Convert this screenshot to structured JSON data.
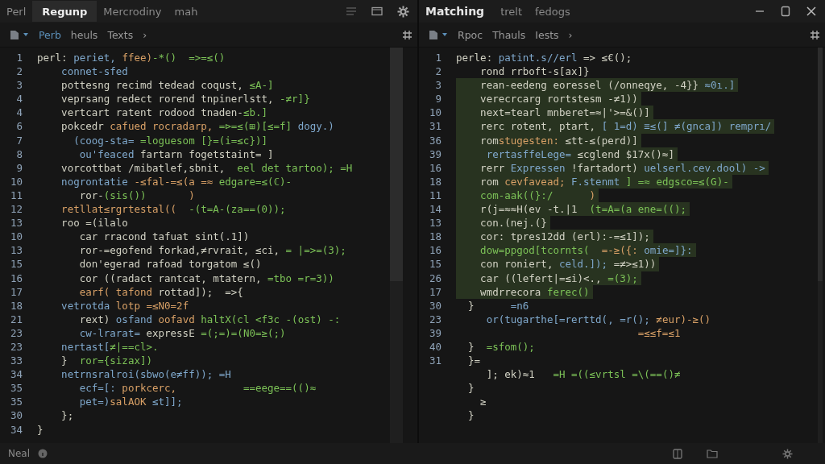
{
  "left_pane": {
    "tabs": [
      {
        "label": "Perl",
        "selected": false
      },
      {
        "label": "Regunp",
        "selected": true
      },
      {
        "label": "Mercrodiny",
        "selected": false
      },
      {
        "label": "mah",
        "selected": false
      }
    ],
    "breadcrumbs": [
      {
        "label": "Perb",
        "selected": true
      },
      {
        "label": "heuls",
        "selected": false
      },
      {
        "label": "Texts",
        "selected": false
      }
    ],
    "breadcrumb_chevron": "›",
    "lines": [
      {
        "num": "1",
        "highlighted": false,
        "segments": [
          {
            "kind": "plain",
            "text": "perl: "
          },
          {
            "kind": "var",
            "text": "periet, "
          },
          {
            "kind": "fn",
            "text": "ffee)"
          },
          {
            "kind": "op",
            "text": "-*()  =>=≤()"
          }
        ]
      },
      {
        "num": "2",
        "highlighted": false,
        "segments": [
          {
            "kind": "var",
            "text": "    connet-sfed"
          }
        ]
      },
      {
        "num": "3",
        "highlighted": false,
        "segments": [
          {
            "kind": "plain",
            "text": "    pottesng recimd tedead coqust, "
          },
          {
            "kind": "op",
            "text": "≤A-]"
          }
        ]
      },
      {
        "num": "4",
        "highlighted": false,
        "segments": [
          {
            "kind": "plain",
            "text": "    veprsang redect rorend tnpinerlstt, "
          },
          {
            "kind": "op",
            "text": "-≠r]}"
          }
        ]
      },
      {
        "num": "4",
        "highlighted": false,
        "segments": [
          {
            "kind": "plain",
            "text": "    vertcart ratent rodood tnaden-"
          },
          {
            "kind": "op",
            "text": "≤b.]"
          }
        ]
      },
      {
        "num": "6",
        "highlighted": false,
        "segments": [
          {
            "kind": "plain",
            "text": "    pokcedr "
          },
          {
            "kind": "fn",
            "text": "cafued rocradarp, "
          },
          {
            "kind": "op",
            "text": "=⊳=≤(⊞)[≤=f] "
          },
          {
            "kind": "var",
            "text": "dogy.)"
          }
        ]
      },
      {
        "num": "7",
        "highlighted": false,
        "segments": [
          {
            "kind": "var",
            "text": "      (coog-sta= "
          },
          {
            "kind": "op",
            "text": "=loguesom [}=(i=≤c})]"
          }
        ]
      },
      {
        "num": "8",
        "highlighted": false,
        "segments": [
          {
            "kind": "var",
            "text": "       ou'feaced "
          },
          {
            "kind": "plain",
            "text": "fartarn fogetstaint= ]"
          }
        ]
      },
      {
        "num": "9",
        "highlighted": false,
        "segments": [
          {
            "kind": "plain",
            "text": "    vorcottbat /mibatlef,sbnit,  "
          },
          {
            "kind": "op",
            "text": "eel det tartoo); =H"
          }
        ]
      },
      {
        "num": "10",
        "highlighted": false,
        "segments": [
          {
            "kind": "var",
            "text": "    nogrontatie "
          },
          {
            "kind": "fn",
            "text": "-≤fal-=≤(a =≈ "
          },
          {
            "kind": "op",
            "text": "edgare=≤(ℂ)-"
          }
        ]
      },
      {
        "num": "11",
        "highlighted": false,
        "segments": [
          {
            "kind": "plain",
            "text": "       ror-"
          },
          {
            "kind": "op",
            "text": "(sis())"
          },
          {
            "kind": "fn",
            "text": "       )"
          }
        ]
      },
      {
        "num": "12",
        "highlighted": false,
        "segments": [
          {
            "kind": "fn",
            "text": "    retllat≤rgrtestal((  "
          },
          {
            "kind": "op",
            "text": "-(t=A-(za==(0));"
          }
        ]
      },
      {
        "num": "13",
        "highlighted": false,
        "segments": [
          {
            "kind": "plain",
            "text": "    roo =(ilalo"
          }
        ]
      },
      {
        "num": "10",
        "highlighted": false,
        "segments": [
          {
            "kind": "plain",
            "text": "       car rracond tafuat sint(.1])"
          }
        ]
      },
      {
        "num": "13",
        "highlighted": false,
        "segments": [
          {
            "kind": "plain",
            "text": "       ror-=egofend forkad,≠rvrait, ≤ci, "
          },
          {
            "kind": "op",
            "text": "= |=>=(3);"
          }
        ]
      },
      {
        "num": "15",
        "highlighted": false,
        "segments": [
          {
            "kind": "plain",
            "text": "       don'egerad rafoad torgatom ≤()"
          }
        ]
      },
      {
        "num": "16",
        "highlighted": false,
        "segments": [
          {
            "kind": "plain",
            "text": "       cor ((radact rantcat, mtatern, "
          },
          {
            "kind": "op",
            "text": "=tbo =r=3))"
          }
        ]
      },
      {
        "num": "17",
        "highlighted": false,
        "segments": [
          {
            "kind": "fn",
            "text": "       earf( tafond "
          },
          {
            "kind": "plain",
            "text": "rottad]);  =>{"
          }
        ]
      },
      {
        "num": "18",
        "highlighted": false,
        "segments": [
          {
            "kind": "var",
            "text": "    vetrotda "
          },
          {
            "kind": "fn",
            "text": "lotp =≤N0=2f"
          }
        ]
      },
      {
        "num": "21",
        "highlighted": false,
        "segments": [
          {
            "kind": "plain",
            "text": "       rext) "
          },
          {
            "kind": "var",
            "text": "osfand "
          },
          {
            "kind": "fn",
            "text": "oofavd "
          },
          {
            "kind": "op",
            "text": "haltX(cl <f3c -(ost) -:"
          }
        ]
      },
      {
        "num": "23",
        "highlighted": false,
        "segments": [
          {
            "kind": "var",
            "text": "       cw-lrarat= "
          },
          {
            "kind": "plain",
            "text": "expressE "
          },
          {
            "kind": "op",
            "text": "=(;=)=(N0=≥(;)"
          }
        ]
      },
      {
        "num": "23",
        "highlighted": false,
        "segments": [
          {
            "kind": "var",
            "text": "    nertast["
          },
          {
            "kind": "op",
            "text": "≠|==cl>."
          }
        ]
      },
      {
        "num": "33",
        "highlighted": false,
        "segments": [
          {
            "kind": "plain",
            "text": "    }  "
          },
          {
            "kind": "op",
            "text": "ror={sizax])"
          }
        ]
      },
      {
        "num": "34",
        "highlighted": false,
        "segments": [
          {
            "kind": "var",
            "text": "    netrnsralroi(sbwo(e≠ff)); =H"
          }
        ]
      },
      {
        "num": "35",
        "highlighted": false,
        "segments": [
          {
            "kind": "var",
            "text": "       ecf=[: "
          },
          {
            "kind": "fn",
            "text": "porkcerc,           "
          },
          {
            "kind": "op",
            "text": "==eege==(()≈"
          }
        ]
      },
      {
        "num": "35",
        "highlighted": false,
        "segments": [
          {
            "kind": "var",
            "text": "       pet=)"
          },
          {
            "kind": "fn",
            "text": "salAOK "
          },
          {
            "kind": "var",
            "text": "≤t]];"
          }
        ]
      },
      {
        "num": "30",
        "highlighted": false,
        "segments": [
          {
            "kind": "plain",
            "text": "    };"
          }
        ]
      },
      {
        "num": "34",
        "highlighted": false,
        "segments": [
          {
            "kind": "plain",
            "text": "}"
          }
        ]
      }
    ]
  },
  "right_pane": {
    "title": "Matching",
    "tabs": [
      {
        "label": "trelt",
        "selected": false
      },
      {
        "label": "fedogs",
        "selected": false
      }
    ],
    "breadcrumbs": [
      {
        "label": "Rpoc",
        "selected": false
      },
      {
        "label": "Thauls",
        "selected": false
      },
      {
        "label": "Iests",
        "selected": false
      }
    ],
    "breadcrumb_chevron": "›",
    "lines": [
      {
        "num": "1",
        "highlighted": false,
        "segments": [
          {
            "kind": "plain",
            "text": "perle: "
          },
          {
            "kind": "var",
            "text": "patint.s//erl "
          },
          {
            "kind": "plain",
            "text": "=> ≤€();"
          }
        ]
      },
      {
        "num": "2",
        "highlighted": false,
        "segments": [
          {
            "kind": "plain",
            "text": "    rond rrboft-s[ax]}"
          }
        ]
      },
      {
        "num": "3",
        "highlighted": true,
        "segments": [
          {
            "kind": "plain",
            "text": "    rean-eedeng eoressel (/onneqye, -4}} "
          },
          {
            "kind": "var",
            "text": "≈0ı.]"
          }
        ]
      },
      {
        "num": "9",
        "highlighted": true,
        "segments": [
          {
            "kind": "plain",
            "text": "    verecrcarg rortstesm -≠1))"
          }
        ]
      },
      {
        "num": "10",
        "highlighted": true,
        "segments": [
          {
            "kind": "plain",
            "text": "    next=tearl mnberet=≈|'>=&()]"
          }
        ]
      },
      {
        "num": "31",
        "highlighted": true,
        "segments": [
          {
            "kind": "plain",
            "text": "    rerc rotent, ptart, "
          },
          {
            "kind": "var",
            "text": "[ 1=d) ≡≤(] ≠(gnca]) remprı/"
          }
        ]
      },
      {
        "num": "36",
        "highlighted": true,
        "segments": [
          {
            "kind": "plain",
            "text": "    rom"
          },
          {
            "kind": "fn",
            "text": "stugesten: "
          },
          {
            "kind": "plain",
            "text": "≤tt-≤(perd)]"
          }
        ]
      },
      {
        "num": "39",
        "highlighted": true,
        "segments": [
          {
            "kind": "var",
            "text": "     rertasffeLege= "
          },
          {
            "kind": "plain",
            "text": "≤cglend $17x()≈]"
          }
        ]
      },
      {
        "num": "16",
        "highlighted": true,
        "segments": [
          {
            "kind": "plain",
            "text": "    rerr "
          },
          {
            "kind": "var",
            "text": "Expressen "
          },
          {
            "kind": "plain",
            "text": "!fartadort) "
          },
          {
            "kind": "var",
            "text": "uelserl.cev.dool) ->"
          }
        ]
      },
      {
        "num": "18",
        "highlighted": true,
        "segments": [
          {
            "kind": "plain",
            "text": "    rom "
          },
          {
            "kind": "fn",
            "text": "cevfavead; "
          },
          {
            "kind": "var",
            "text": "F.stenmt "
          },
          {
            "kind": "op",
            "text": "] =≈ edgsco=≤(G)-"
          }
        ]
      },
      {
        "num": "11",
        "highlighted": true,
        "segments": [
          {
            "kind": "op",
            "text": "    com-aak((}:/"
          },
          {
            "kind": "fn",
            "text": "      )"
          }
        ]
      },
      {
        "num": "14",
        "highlighted": true,
        "segments": [
          {
            "kind": "plain",
            "text": "    r(j=≈≈H(ev -t.|1  "
          },
          {
            "kind": "op",
            "text": "(t=A=(a ene=(();"
          }
        ]
      },
      {
        "num": "13",
        "highlighted": true,
        "segments": [
          {
            "kind": "plain",
            "text": "    con.(nej.(}"
          }
        ]
      },
      {
        "num": "18",
        "highlighted": true,
        "segments": [
          {
            "kind": "plain",
            "text": "    cor: tpres12dd (erl):-=≤1]);"
          }
        ]
      },
      {
        "num": "16",
        "highlighted": true,
        "segments": [
          {
            "kind": "op",
            "text": "    dow=ppgod[tcornts(  "
          },
          {
            "kind": "fn",
            "text": "=-≥({: "
          },
          {
            "kind": "var",
            "text": "omie=]}:"
          }
        ]
      },
      {
        "num": "15",
        "highlighted": true,
        "segments": [
          {
            "kind": "plain",
            "text": "    con roniert, "
          },
          {
            "kind": "var",
            "text": "celd.]); "
          },
          {
            "kind": "plain",
            "text": "=≠>≤1))"
          }
        ]
      },
      {
        "num": "26",
        "highlighted": true,
        "segments": [
          {
            "kind": "plain",
            "text": "    car ((lefert|=≤i)<., "
          },
          {
            "kind": "op",
            "text": "=(3);"
          }
        ]
      },
      {
        "num": "17",
        "highlighted": true,
        "segments": [
          {
            "kind": "plain",
            "text": "    wmdrrecora "
          },
          {
            "kind": "op",
            "text": "ferec()"
          }
        ]
      },
      {
        "num": "30",
        "highlighted": false,
        "segments": [
          {
            "kind": "plain",
            "text": "  }      "
          },
          {
            "kind": "var",
            "text": "=n6"
          }
        ]
      },
      {
        "num": "23",
        "highlighted": false,
        "segments": [
          {
            "kind": "var",
            "text": "     or(tugarthe[=rerttd(, =r(); "
          },
          {
            "kind": "fn",
            "text": "≠eur)-≥()"
          }
        ]
      },
      {
        "num": "39",
        "highlighted": false,
        "segments": [
          {
            "kind": "fn",
            "text": "                              =≤≤f=≤1"
          }
        ]
      },
      {
        "num": "40",
        "highlighted": false,
        "segments": [
          {
            "kind": "plain",
            "text": "  }  "
          },
          {
            "kind": "op",
            "text": "=sfom();"
          }
        ]
      },
      {
        "num": "31",
        "highlighted": false,
        "segments": [
          {
            "kind": "plain",
            "text": "  }="
          }
        ]
      },
      {
        "highlighted": false,
        "segments": [
          {
            "kind": "plain",
            "text": "     ]; ek)≈1   "
          },
          {
            "kind": "op",
            "text": "=H =((≤vrtsl =\\(==()≠"
          }
        ]
      },
      {
        "highlighted": false,
        "segments": [
          {
            "kind": "plain",
            "text": "  }"
          }
        ]
      },
      {
        "highlighted": false,
        "segments": [
          {
            "kind": "plain",
            "text": "    ≥"
          }
        ]
      },
      {
        "highlighted": false,
        "segments": [
          {
            "kind": "plain",
            "text": "  }"
          }
        ]
      }
    ]
  },
  "status_bar": {
    "label": "Neal"
  }
}
